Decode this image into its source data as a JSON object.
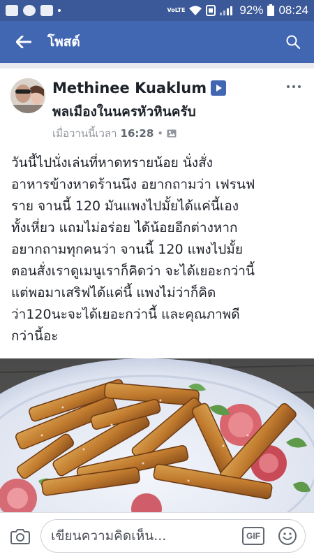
{
  "status_bar": {
    "volte": "VoLTE",
    "battery": "92%",
    "time": "08:24"
  },
  "app_bar": {
    "title": "โพสต์"
  },
  "post": {
    "author": "Methinee Kuaklum",
    "group": "พลเมืองในนครหัวหินครับ",
    "time_prefix": "เมื่อวานนี้เวลา",
    "time": "16:28",
    "text_lines": [
      "วันนี้ไปนั่งเล่นที่หาดทรายน้อย นั่งสั่ง",
      "อาหารข้างหาดร้านนึง อยากถามว่า เฟรนฟ",
      "ราย จานนี้ 120 มันแพงไปมั้ยได้แค่นี้เอง",
      "ทั้งเหี่ยว แถมไม่อร่อย ได้น้อยอีกต่างหาก",
      "อยากถามทุกคนว่า จานนี้ 120 แพงไปมั้ย",
      "ตอนสั่งเราดูเมนูเราก็คิดว่า จะได้เยอะกว่านี้",
      "แต่พอมาเสริฟได้แค่นี้ แพงไม่ว่าก็คิด",
      "ว่า120นะจะได้เยอะกว่านี้ และคุณภาพดี",
      "กว่านี้อะ"
    ]
  },
  "comment_bar": {
    "placeholder": "เขียนความคิดเห็น...",
    "gif_label": "GIF"
  },
  "icons": {
    "back": "arrow-left-icon",
    "search": "search-icon",
    "camera": "camera-icon",
    "emoji": "smiley-icon",
    "more": "more-horizontal-icon",
    "audience": "photo-audience-icon"
  },
  "colors": {
    "status_bar": "#3b5998",
    "app_bar": "#4267b2",
    "text": "#1d2129",
    "meta": "#90949c"
  }
}
